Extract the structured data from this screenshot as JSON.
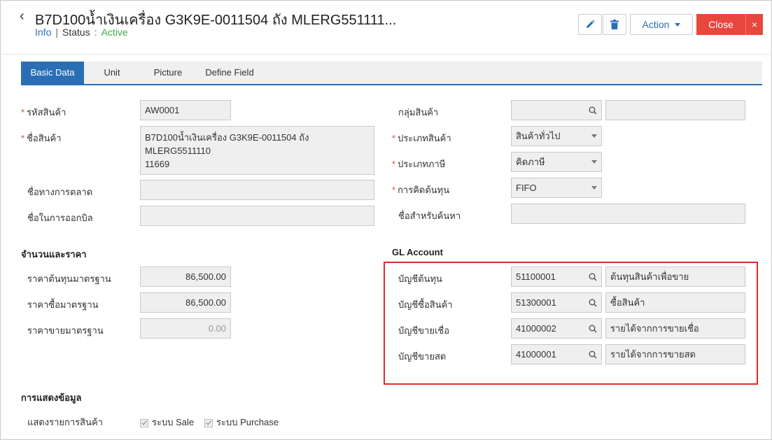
{
  "header": {
    "title": "B7D100น้ำเงินเครื่อง G3K9E-0011504 ถัง MLERG551111...",
    "info_label": "Info",
    "status_label": "Status",
    "status_value": "Active",
    "action_label": "Action",
    "close_label": "Close",
    "close_x": "×"
  },
  "tabs": [
    "Basic Data",
    "Unit",
    "Picture",
    "Define Field"
  ],
  "left": {
    "product_code_label": "รหัสสินค้า",
    "product_code": "AW0001",
    "product_name_label": "ชื่อสินค้า",
    "product_name": "B7D100น้ำเงินเครื่อง G3K9E-0011504 ถัง MLERG5511110\n11669",
    "marketing_name_label": "ชื่อทางการตลาด",
    "billing_name_label": "ชื่อในการออกบิล"
  },
  "right": {
    "group_label": "กลุ่มสินค้า",
    "type_label": "ประเภทสินค้า",
    "type_value": "สินค้าทั่วไป",
    "tax_label": "ประเภทภาษี",
    "tax_value": "คิดภาษี",
    "cost_label": "การคิดต้นทุน",
    "cost_value": "FIFO",
    "search_name_label": "ชื่อสำหรับค้นหา"
  },
  "pricing": {
    "section_title": "จำนวนและราคา",
    "std_cost_label": "ราคาต้นทุนมาตรฐาน",
    "std_cost": "86,500.00",
    "std_buy_label": "ราคาซื้อมาตรฐาน",
    "std_buy": "86,500.00",
    "std_sell_label": "ราคาขายมาตรฐาน",
    "std_sell": "0.00"
  },
  "gl": {
    "section_title": "GL Account",
    "rows": [
      {
        "label": "บัญชีต้นทุน",
        "code": "51100001",
        "name": "ต้นทุนสินค้าเพื่อขาย"
      },
      {
        "label": "บัญชีซื้อสินค้า",
        "code": "51300001",
        "name": "ซื้อสินค้า"
      },
      {
        "label": "บัญชีขายเชื่อ",
        "code": "41000002",
        "name": "รายได้จากการขายเชื่อ"
      },
      {
        "label": "บัญชีขายสด",
        "code": "41000001",
        "name": "รายได้จากการขายสด"
      }
    ]
  },
  "display": {
    "section_title": "การแสดงข้อมูล",
    "show_label": "แสดงรายการสินค้า",
    "sale_label": "ระบบ Sale",
    "purchase_label": "ระบบ Purchase"
  },
  "colors": {
    "accent": "#2a6fb5",
    "danger": "#e8473e",
    "active": "#3ea84e",
    "highlight_box": "#e02a2a"
  }
}
